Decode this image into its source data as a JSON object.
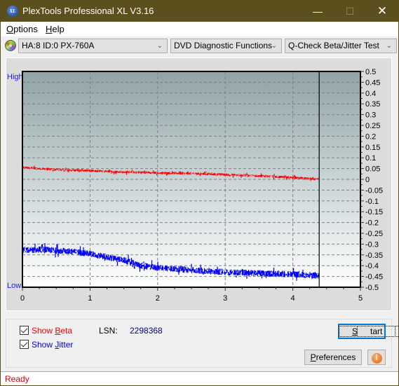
{
  "window": {
    "title": "PlexTools Professional XL V3.16",
    "app_icon": "XL",
    "controls": [
      "minimize-icon",
      "maximize-icon",
      "close-icon"
    ]
  },
  "menu": {
    "items": [
      {
        "label": "Options",
        "accel": "O"
      },
      {
        "label": "Help",
        "accel": "H"
      }
    ]
  },
  "toolbar": {
    "drive_icon": "disc-icon",
    "drive_select": "HA:8 ID:0  PX-760A",
    "function_select": "DVD Diagnostic Functions",
    "test_select": "Q-Check Beta/Jitter Test"
  },
  "chart_data": {
    "type": "line",
    "title": "",
    "xlabel": "",
    "ylabel": "",
    "left_axis_labels": {
      "top": "High",
      "bottom": "Low"
    },
    "xlim": [
      0,
      5
    ],
    "ylim": [
      -0.5,
      0.5
    ],
    "x_ticks": [
      "0",
      "1",
      "2",
      "3",
      "4",
      "5"
    ],
    "y_ticks": [
      "0.5",
      "0.45",
      "0.4",
      "0.35",
      "0.3",
      "0.25",
      "0.2",
      "0.15",
      "0.1",
      "0.05",
      "0",
      "-0.05",
      "-0.1",
      "-0.15",
      "-0.2",
      "-0.25",
      "-0.3",
      "-0.35",
      "-0.4",
      "-0.45",
      "-0.5"
    ],
    "grid": true,
    "cursor_x": 4.39,
    "series": [
      {
        "name": "Beta",
        "color": "#ff0000",
        "noise": 0.012,
        "x": [
          0,
          0.25,
          0.5,
          1.0,
          1.5,
          2.0,
          2.5,
          3.0,
          3.5,
          4.0,
          4.39
        ],
        "values": [
          0.055,
          0.05,
          0.045,
          0.04,
          0.034,
          0.03,
          0.027,
          0.022,
          0.016,
          0.008,
          0.0
        ]
      },
      {
        "name": "Jitter",
        "color": "#0000ff",
        "noise": 0.03,
        "x": [
          0,
          0.25,
          0.5,
          0.75,
          1.0,
          1.25,
          1.5,
          1.75,
          2.0,
          2.5,
          3.0,
          3.5,
          4.0,
          4.39
        ],
        "values": [
          -0.33,
          -0.325,
          -0.33,
          -0.335,
          -0.345,
          -0.36,
          -0.375,
          -0.4,
          -0.41,
          -0.42,
          -0.43,
          -0.435,
          -0.44,
          -0.445
        ]
      }
    ]
  },
  "controls": {
    "show_beta": {
      "label": "Show Beta",
      "accel": "B",
      "checked": true,
      "color": "#ff0000"
    },
    "show_jitter": {
      "label": "Show Jitter",
      "accel": "J",
      "checked": true,
      "color": "#0000ff"
    },
    "lsn_label": "LSN:",
    "lsn_value": "2298368",
    "start_button": "Start",
    "preferences_button": "Preferences",
    "info_button": "i"
  },
  "status": {
    "text": "Ready"
  }
}
